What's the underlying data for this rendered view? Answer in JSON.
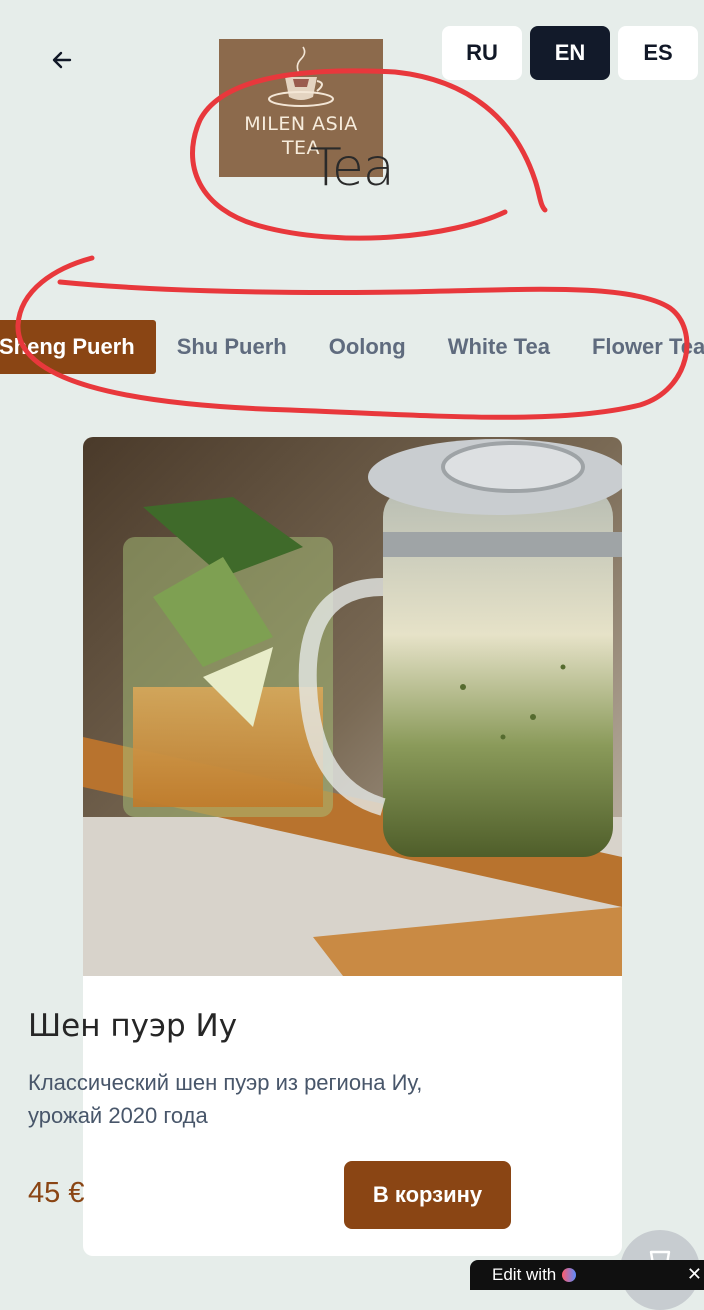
{
  "header": {
    "back_icon": "arrow-left-icon",
    "languages": [
      {
        "code": "RU",
        "active": false
      },
      {
        "code": "EN",
        "active": true
      },
      {
        "code": "ES",
        "active": false
      }
    ],
    "logo": {
      "line1": "MILEN ASIA",
      "line2": "TEA"
    },
    "title": "Tea"
  },
  "tabs": [
    {
      "label": "Sheng Puerh",
      "active": true
    },
    {
      "label": "Shu Puerh",
      "active": false
    },
    {
      "label": "Oolong",
      "active": false
    },
    {
      "label": "White Tea",
      "active": false
    },
    {
      "label": "Flower Tea",
      "active": false
    }
  ],
  "product": {
    "title": "Шен пуэр Иу",
    "description": "Классический шен пуэр из региона Иу, урожай 2020 года",
    "price": "45 €",
    "cart_label": "В корзину"
  },
  "badge": {
    "text": "Edit with"
  },
  "colors": {
    "accent": "#8a4514",
    "background": "#e6edea",
    "annotation": "#e8383c"
  }
}
